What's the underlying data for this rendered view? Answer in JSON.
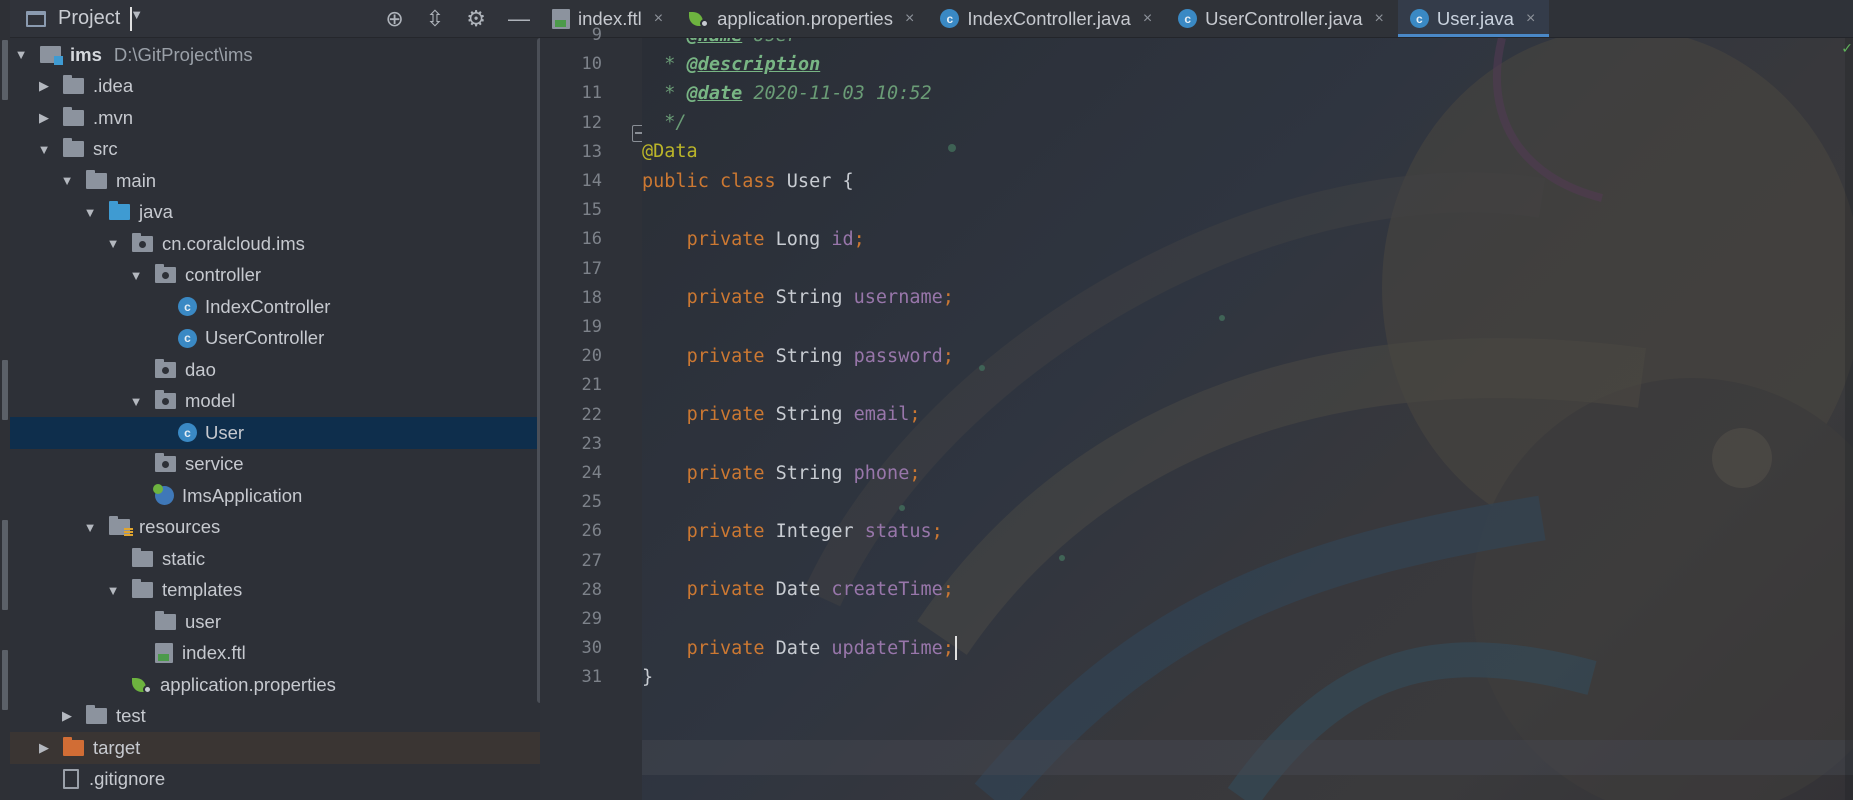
{
  "project_panel": {
    "title": "Project",
    "tree": [
      {
        "label": "ims",
        "path": "D:\\GitProject\\ims",
        "indent": 0,
        "arrow": "down",
        "icon": "module"
      },
      {
        "label": ".idea",
        "indent": 1,
        "arrow": "right",
        "icon": "folder"
      },
      {
        "label": ".mvn",
        "indent": 1,
        "arrow": "right",
        "icon": "folder"
      },
      {
        "label": "src",
        "indent": 1,
        "arrow": "down",
        "icon": "folder"
      },
      {
        "label": "main",
        "indent": 2,
        "arrow": "down",
        "icon": "folder"
      },
      {
        "label": "java",
        "indent": 3,
        "arrow": "down",
        "icon": "folder-blue"
      },
      {
        "label": "cn.coralcloud.ims",
        "indent": 4,
        "arrow": "down",
        "icon": "package"
      },
      {
        "label": "controller",
        "indent": 5,
        "arrow": "down",
        "icon": "package"
      },
      {
        "label": "IndexController",
        "indent": 6,
        "arrow": "none",
        "icon": "class"
      },
      {
        "label": "UserController",
        "indent": 6,
        "arrow": "none",
        "icon": "class"
      },
      {
        "label": "dao",
        "indent": 5,
        "arrow": "none",
        "icon": "package"
      },
      {
        "label": "model",
        "indent": 5,
        "arrow": "down",
        "icon": "package"
      },
      {
        "label": "User",
        "indent": 6,
        "arrow": "none",
        "icon": "class",
        "selected": true
      },
      {
        "label": "service",
        "indent": 5,
        "arrow": "none",
        "icon": "package"
      },
      {
        "label": "ImsApplication",
        "indent": 5,
        "arrow": "none",
        "icon": "spring-class"
      },
      {
        "label": "resources",
        "indent": 3,
        "arrow": "down",
        "icon": "resources"
      },
      {
        "label": "static",
        "indent": 4,
        "arrow": "none",
        "icon": "folder"
      },
      {
        "label": "templates",
        "indent": 4,
        "arrow": "down",
        "icon": "folder"
      },
      {
        "label": "user",
        "indent": 5,
        "arrow": "none",
        "icon": "folder"
      },
      {
        "label": "index.ftl",
        "indent": 5,
        "arrow": "none",
        "icon": "ftl"
      },
      {
        "label": "application.properties",
        "indent": 4,
        "arrow": "none",
        "icon": "spring-props"
      },
      {
        "label": "test",
        "indent": 2,
        "arrow": "right",
        "icon": "folder"
      },
      {
        "label": "target",
        "indent": 1,
        "arrow": "right",
        "icon": "folder-orange",
        "highlight": true
      },
      {
        "label": ".gitignore",
        "indent": 1,
        "arrow": "none",
        "icon": "file"
      }
    ]
  },
  "tabs": [
    {
      "label": "index.ftl",
      "icon": "ftl",
      "active": false
    },
    {
      "label": "application.properties",
      "icon": "spring-props",
      "active": false
    },
    {
      "label": "IndexController.java",
      "icon": "class",
      "active": false
    },
    {
      "label": "UserController.java",
      "icon": "class",
      "active": false
    },
    {
      "label": "User.java",
      "icon": "class",
      "active": true
    }
  ],
  "tab_close_glyph": "×",
  "editor": {
    "lines": [
      {
        "n": "9",
        "tokens": [
          [
            "doc",
            "  * "
          ],
          [
            "tag",
            "@name"
          ],
          [
            "doc",
            " User"
          ]
        ]
      },
      {
        "n": "10",
        "tokens": [
          [
            "doc",
            "  * "
          ],
          [
            "tag",
            "@description"
          ]
        ]
      },
      {
        "n": "11",
        "tokens": [
          [
            "doc",
            "  * "
          ],
          [
            "tag",
            "@date"
          ],
          [
            "doc",
            " 2020-11-03 10:52"
          ]
        ]
      },
      {
        "n": "12",
        "tokens": [
          [
            "doc",
            "  */"
          ]
        ]
      },
      {
        "n": "13",
        "tokens": [
          [
            "ann",
            "@Data"
          ]
        ]
      },
      {
        "n": "14",
        "tokens": [
          [
            "kw",
            "public class "
          ],
          [
            "plain",
            "User {"
          ]
        ]
      },
      {
        "n": "15",
        "tokens": []
      },
      {
        "n": "16",
        "tokens": [
          [
            "plain",
            "    "
          ],
          [
            "kw",
            "private "
          ],
          [
            "type",
            "Long "
          ],
          [
            "field",
            "id"
          ],
          [
            "punct",
            ";"
          ]
        ]
      },
      {
        "n": "17",
        "tokens": []
      },
      {
        "n": "18",
        "tokens": [
          [
            "plain",
            "    "
          ],
          [
            "kw",
            "private "
          ],
          [
            "type",
            "String "
          ],
          [
            "field",
            "username"
          ],
          [
            "punct",
            ";"
          ]
        ]
      },
      {
        "n": "19",
        "tokens": []
      },
      {
        "n": "20",
        "tokens": [
          [
            "plain",
            "    "
          ],
          [
            "kw",
            "private "
          ],
          [
            "type",
            "String "
          ],
          [
            "field",
            "password"
          ],
          [
            "punct",
            ";"
          ]
        ]
      },
      {
        "n": "21",
        "tokens": []
      },
      {
        "n": "22",
        "tokens": [
          [
            "plain",
            "    "
          ],
          [
            "kw",
            "private "
          ],
          [
            "type",
            "String "
          ],
          [
            "field",
            "email"
          ],
          [
            "punct",
            ";"
          ]
        ]
      },
      {
        "n": "23",
        "tokens": []
      },
      {
        "n": "24",
        "tokens": [
          [
            "plain",
            "    "
          ],
          [
            "kw",
            "private "
          ],
          [
            "type",
            "String "
          ],
          [
            "field",
            "phone"
          ],
          [
            "punct",
            ";"
          ]
        ]
      },
      {
        "n": "25",
        "tokens": []
      },
      {
        "n": "26",
        "tokens": [
          [
            "plain",
            "    "
          ],
          [
            "kw",
            "private "
          ],
          [
            "type",
            "Integer "
          ],
          [
            "field",
            "status"
          ],
          [
            "punct",
            ";"
          ]
        ]
      },
      {
        "n": "27",
        "tokens": []
      },
      {
        "n": "28",
        "tokens": [
          [
            "plain",
            "    "
          ],
          [
            "kw",
            "private "
          ],
          [
            "type",
            "Date "
          ],
          [
            "field",
            "createTime"
          ],
          [
            "punct",
            ";"
          ]
        ]
      },
      {
        "n": "29",
        "tokens": []
      },
      {
        "n": "30",
        "tokens": [
          [
            "plain",
            "    "
          ],
          [
            "kw",
            "private "
          ],
          [
            "type",
            "Date "
          ],
          [
            "field",
            "updateTime"
          ],
          [
            "punct",
            ";"
          ]
        ],
        "current": true
      },
      {
        "n": "31",
        "tokens": [
          [
            "plain",
            "}"
          ]
        ]
      }
    ]
  },
  "colors": {
    "keyword": "#cc7832",
    "annotation": "#bbb529",
    "field": "#9876aa",
    "javadoc": "#6a9c76",
    "selection": "#0e2e4c",
    "tab_underline": "#4a88c7"
  }
}
